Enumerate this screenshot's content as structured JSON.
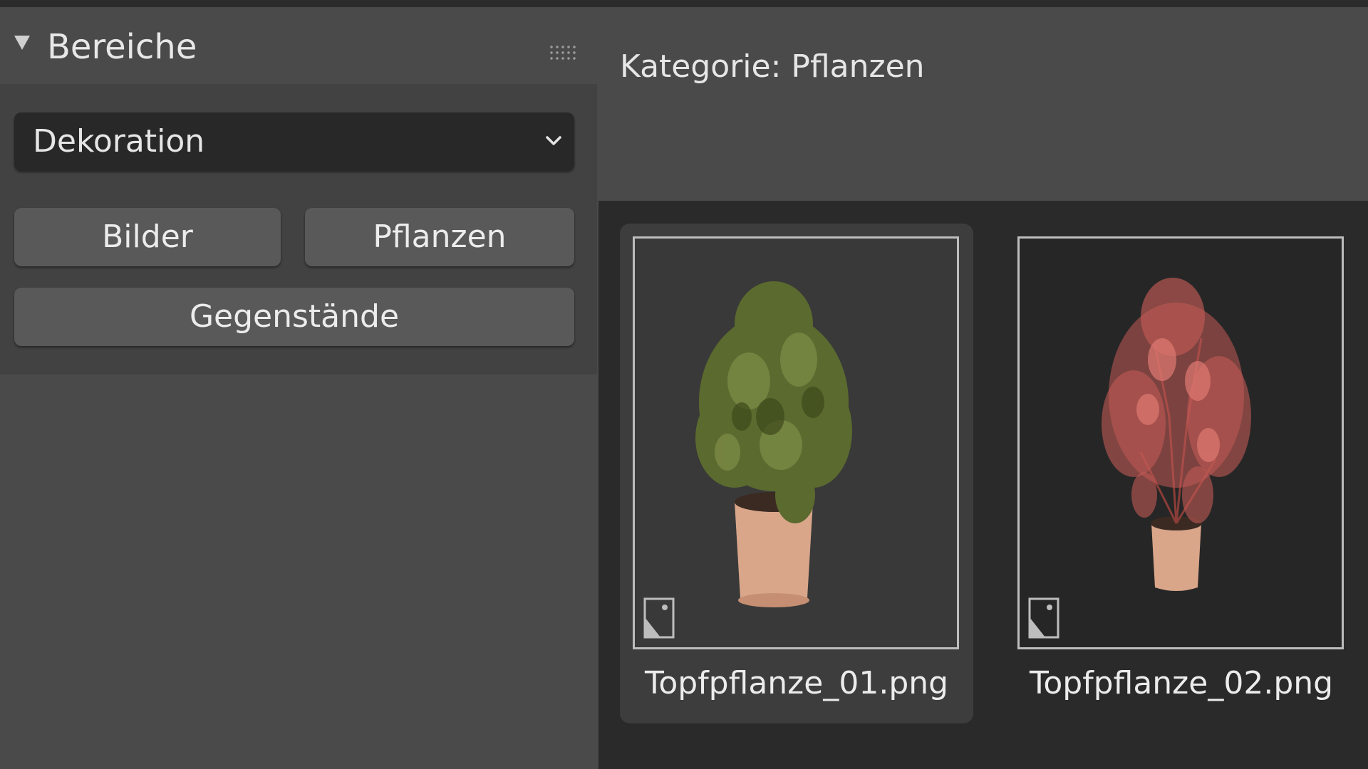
{
  "panel": {
    "title": "Bereiche",
    "library_dropdown": {
      "selected": "Dekoration"
    },
    "catalog_buttons": [
      {
        "label": "Bilder"
      },
      {
        "label": "Pflanzen"
      },
      {
        "label": "Gegenstände"
      }
    ]
  },
  "browser": {
    "category_label": "Kategorie: Pflanzen",
    "assets": [
      {
        "filename": "Topfpflanze_01.png",
        "selected": true,
        "foliage_color": "#5b6a2e"
      },
      {
        "filename": "Topfpflanze_02.png",
        "selected": false,
        "foliage_color": "#c25a55"
      }
    ]
  },
  "icons": {
    "collapse": "disclosure-triangle-down-icon",
    "grip": "drag-grip-icon",
    "dropdown": "chevron-down-icon",
    "image_type": "image-file-icon"
  },
  "colors": {
    "panel_bg": "#4a4a4a",
    "panel_body_bg": "#424242",
    "grid_bg": "#2a2a2a",
    "button_bg": "#595959",
    "dropdown_bg": "#282828",
    "pot": "#d9a68a"
  }
}
